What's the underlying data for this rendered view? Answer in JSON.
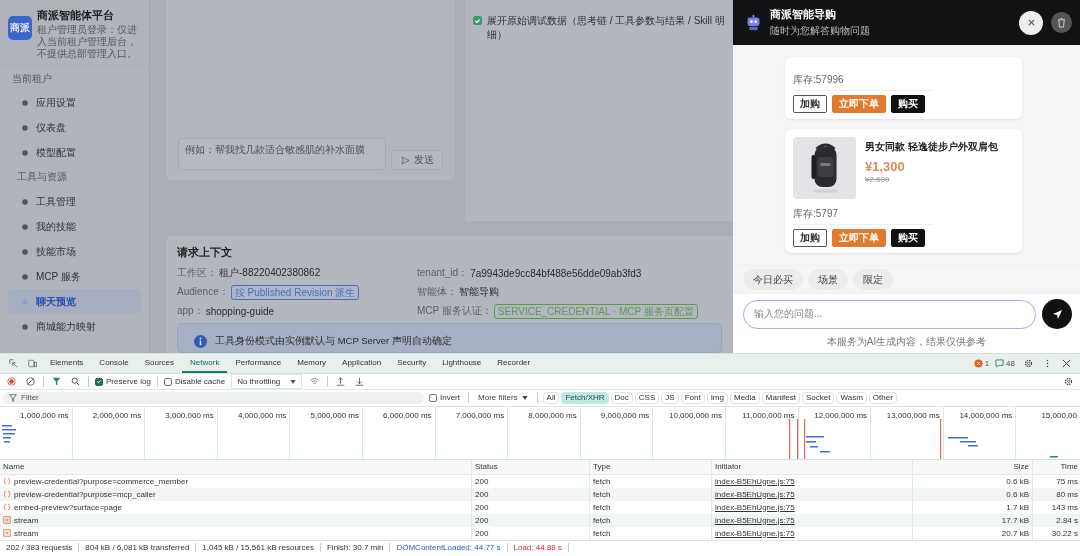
{
  "sidebar": {
    "logo": "商派",
    "title": "商派智能体平台",
    "description": "租户管理员登录：仅进入当前租户管理后台，不提供总部管理入口。",
    "section_label": "当前租户",
    "items": [
      {
        "kind": "item",
        "label": "应用设置",
        "selected": false
      },
      {
        "kind": "item",
        "label": "仪表盘",
        "selected": false
      },
      {
        "kind": "item",
        "label": "模型配置",
        "selected": false
      },
      {
        "kind": "heading",
        "label": "工具与资源"
      },
      {
        "kind": "item",
        "label": "工具管理",
        "selected": false
      },
      {
        "kind": "item",
        "label": "我的技能",
        "selected": false
      },
      {
        "kind": "item",
        "label": "技能市场",
        "selected": false
      },
      {
        "kind": "item",
        "label": "MCP 服务",
        "selected": false
      },
      {
        "kind": "item",
        "label": "聊天预览",
        "selected": true
      },
      {
        "kind": "item",
        "label": "商城能力映射",
        "selected": false
      }
    ]
  },
  "main": {
    "prompt": {
      "placeholder": "例如：帮我找几款适合敏感肌的补水面膜",
      "send_label": "发送"
    },
    "debug_toggle": {
      "label": "展开原始调试数据（思考链 / 工具参数与结果 / Skill 明细）",
      "checked": true
    },
    "context": {
      "title": "请求上下文",
      "fields": [
        {
          "label": "工作区：",
          "value": "租户-88220402380862",
          "kind": "text"
        },
        {
          "label": "tenant_id：",
          "value": "7a9943de9cc84bf488e56dde09ab3fd3",
          "kind": "text"
        },
        {
          "label": "Audience：",
          "value": "按 Published Revision 派生",
          "kind": "tag",
          "color": "#4a6fc9"
        },
        {
          "label": "智能体：",
          "value": "智能导购",
          "kind": "text"
        },
        {
          "label": "app：",
          "value": "shopping-guide",
          "kind": "text"
        },
        {
          "label": "MCP 服务认证：",
          "value": "SERVICE_CREDENTIAL · MCP 服务页配置",
          "kind": "tag",
          "color": "#5f9a4f"
        }
      ],
      "alert": "工具身份模式由实例默认与 MCP Server 声明自动确定"
    }
  },
  "chat": {
    "title": "商派智能导购",
    "subtitle": "随时为您解答购物问题",
    "products": [
      {
        "stock": "库存:57996",
        "buttons": [
          {
            "label": "加购",
            "kind": "outline"
          },
          {
            "label": "立即下单",
            "kind": "primary"
          },
          {
            "label": "购买",
            "kind": "dark"
          }
        ]
      },
      {
        "name": "男女同款 轻逸徒步户外双肩包",
        "price": "¥1,300",
        "original_price": "¥2,600",
        "stock": "库存:5797",
        "buttons": [
          {
            "label": "加购",
            "kind": "outline"
          },
          {
            "label": "立即下单",
            "kind": "primary"
          },
          {
            "label": "购买",
            "kind": "dark"
          }
        ]
      }
    ],
    "chips": [
      "今日必买",
      "场景",
      "限定"
    ],
    "input": {
      "placeholder": "输入您的问题..."
    },
    "footer": "本服务为AI生成内容，结果仅供参考"
  },
  "devtools": {
    "tabs": [
      {
        "label": "Elements",
        "selected": false
      },
      {
        "label": "Console",
        "selected": false
      },
      {
        "label": "Sources",
        "selected": false
      },
      {
        "label": "Network",
        "selected": true
      },
      {
        "label": "Performance",
        "selected": false
      },
      {
        "label": "Memory",
        "selected": false
      },
      {
        "label": "Application",
        "selected": false
      },
      {
        "label": "Security",
        "selected": false
      },
      {
        "label": "Lighthouse",
        "selected": false
      },
      {
        "label": "Recorder",
        "selected": false
      }
    ],
    "error_count": "1",
    "message_count": "48",
    "preserve_log": {
      "label": "Preserve log",
      "checked": true
    },
    "disable_cache": {
      "label": "Disable cache",
      "checked": false
    },
    "throttling": "No throttling",
    "filter": {
      "placeholder": "Filter"
    },
    "invert": {
      "label": "Invert",
      "checked": false
    },
    "more_filters": "More filters",
    "type_filters": [
      {
        "label": "All",
        "selected": false
      },
      {
        "label": "Fetch/XHR",
        "selected": true
      },
      {
        "label": "Doc",
        "selected": false
      },
      {
        "label": "CSS",
        "selected": false
      },
      {
        "label": "JS",
        "selected": false
      },
      {
        "label": "Font",
        "selected": false
      },
      {
        "label": "Img",
        "selected": false
      },
      {
        "label": "Media",
        "selected": false
      },
      {
        "label": "Manifest",
        "selected": false
      },
      {
        "label": "Socket",
        "selected": false
      },
      {
        "label": "Wasm",
        "selected": false
      },
      {
        "label": "Other",
        "selected": false
      }
    ],
    "overview_ticks": [
      "1,000,000 ms",
      "2,000,000 ms",
      "3,000,000 ms",
      "4,000,000 ms",
      "5,000,000 ms",
      "6,000,000 ms",
      "7,000,000 ms",
      "8,000,000 ms",
      "9,000,000 ms",
      "10,000,000 ms",
      "11,000,000 ms",
      "12,000,000 ms",
      "13,000,000 ms",
      "14,000,000 ms",
      "15,000,00"
    ],
    "table": {
      "columns": [
        "Name",
        "Status",
        "Type",
        "Initiator",
        "Size",
        "Time"
      ],
      "rows": [
        {
          "kind": "fetch",
          "name": "preview-credential?purpose=commerce_member",
          "status": "200",
          "type": "fetch",
          "initiator": "index-B5EhUgne.js:75",
          "size": "0.6 kB",
          "time": "75 ms"
        },
        {
          "kind": "fetch",
          "name": "preview-credential?purpose=mcp_caller",
          "status": "200",
          "type": "fetch",
          "initiator": "index-B5EhUgne.js:75",
          "size": "0.6 kB",
          "time": "80 ms"
        },
        {
          "kind": "fetch",
          "name": "embed-preview?surface=page",
          "status": "200",
          "type": "fetch",
          "initiator": "index-B5EhUgne.js:75",
          "size": "1.7 kB",
          "time": "143 ms"
        },
        {
          "kind": "document",
          "name": "stream",
          "status": "200",
          "type": "fetch",
          "initiator": "index-B5EhUgne.js:75",
          "size": "17.7 kB",
          "time": "2.84 s"
        },
        {
          "kind": "document",
          "name": "stream",
          "status": "200",
          "type": "fetch",
          "initiator": "index-B5EhUgne.js:75",
          "size": "20.7 kB",
          "time": "30.22 s"
        }
      ]
    },
    "status_bar": [
      {
        "text": "202 / 383 requests",
        "kind": "plain"
      },
      {
        "text": "804 kB / 6,081 kB transferred",
        "kind": "plain"
      },
      {
        "text": "1,045 kB / 15,561 kB resources",
        "kind": "plain"
      },
      {
        "text": "Finish: 30.7 min",
        "kind": "plain"
      },
      {
        "text": "DOMContentLoaded: 44.77 s",
        "kind": "blue"
      },
      {
        "text": "Load: 44.88 s",
        "kind": "red"
      }
    ]
  }
}
